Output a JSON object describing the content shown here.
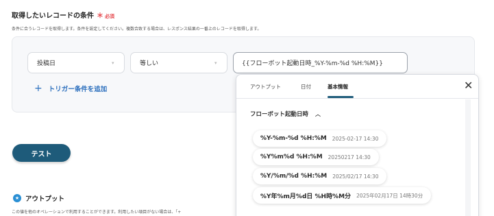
{
  "condition": {
    "title": "取得したいレコードの条件",
    "required_mark": "＊",
    "required_text": "必須",
    "description": "条件に合うレコードを取得します。条件を設定してください。複数合致する場合は、レスポンス結果の一番上のレコードを取得します。",
    "field_select": "投稿日",
    "operator_select": "等しい",
    "value_input": "{{フローボット起動日時_%Y-%m-%d %H:%M}}",
    "add_trigger": "トリガー条件を追加"
  },
  "test_button": "テスト",
  "output": {
    "title": "アウトプット",
    "description": "この値を他のオペレーションで利用することができます。利用したい項目がない場合は、「+"
  },
  "popup": {
    "tabs": [
      "アウトプット",
      "日付",
      "基本情報"
    ],
    "active_tab": "基本情報",
    "group_title": "フローボット起動日時",
    "items": [
      {
        "format": "%Y-%m-%d %H:%M",
        "sample": "2025-02-17 14:30"
      },
      {
        "format": "%Y%m%d %H:%M",
        "sample": "20250217 14:30"
      },
      {
        "format": "%Y/%m/%d %H:%M",
        "sample": "2025/02/17 14:30"
      },
      {
        "format": "%Y年%m月%d日 %H時%M分",
        "sample": "2025年02月17日 14時30分"
      }
    ]
  }
}
